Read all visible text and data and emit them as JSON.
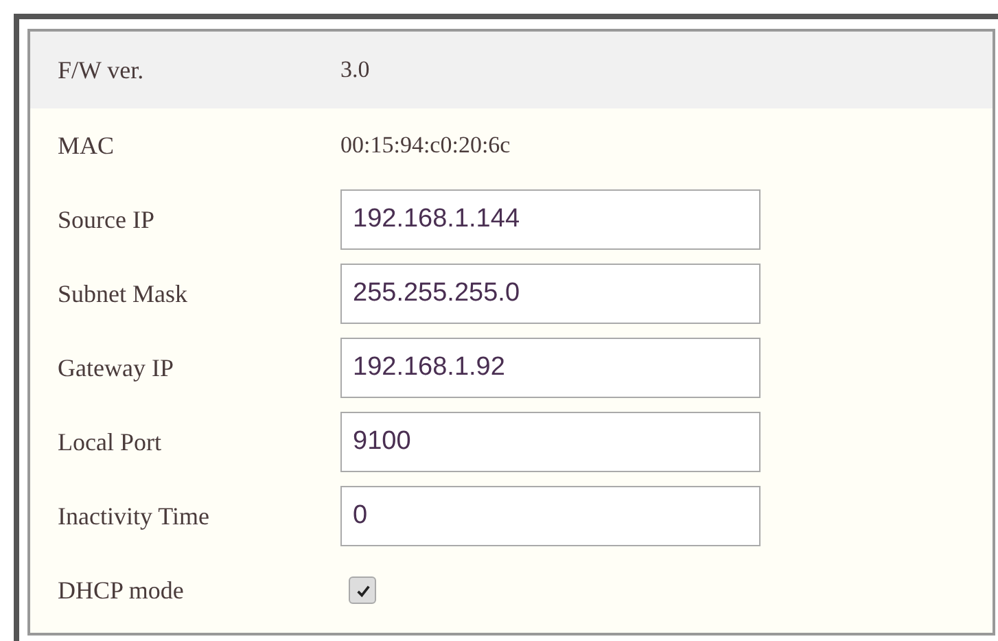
{
  "rows": [
    {
      "kind": "text",
      "label": "F/W ver.",
      "value": "3.0",
      "header": true
    },
    {
      "kind": "text",
      "label": "MAC",
      "value": "00:15:94:c0:20:6c",
      "header": false
    },
    {
      "kind": "input",
      "label": "Source IP",
      "value": "192.168.1.144"
    },
    {
      "kind": "input",
      "label": "Subnet Mask",
      "value": "255.255.255.0"
    },
    {
      "kind": "input",
      "label": "Gateway IP",
      "value": "192.168.1.92"
    },
    {
      "kind": "input",
      "label": "Local Port",
      "value": "9100"
    },
    {
      "kind": "input",
      "label": "Inactivity Time",
      "value": "0"
    },
    {
      "kind": "checkbox",
      "label": "DHCP mode",
      "checked": true
    }
  ]
}
